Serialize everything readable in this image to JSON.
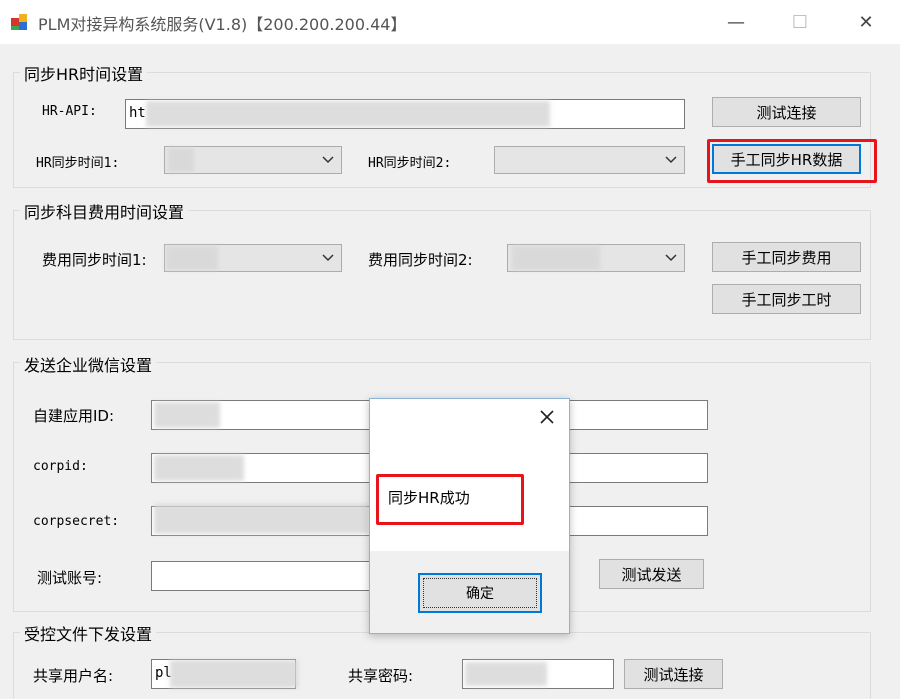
{
  "window": {
    "title": "PLM对接异构系统服务(V1.8)【200.200.200.44】",
    "minimize_glyph": "—",
    "maximize_glyph": "☐",
    "close_glyph": "✕"
  },
  "hr_group": {
    "label": "同步HR时间设置",
    "api_label": "HR-API:",
    "api_value": "ht",
    "time1_label": "HR同步时间1:",
    "time2_label": "HR同步时间2:",
    "test_button": "测试连接",
    "sync_button": "手工同步HR数据"
  },
  "cost_group": {
    "label": "同步科目费用时间设置",
    "time1_label": "费用同步时间1:",
    "time2_label": "费用同步时间2:",
    "sync_cost_button": "手工同步费用",
    "sync_hours_button": "手工同步工时"
  },
  "wechat_group": {
    "label": "发送企业微信设置",
    "appid_label": "自建应用ID:",
    "corpid_label": "corpid:",
    "corpsecret_label": "corpsecret:",
    "test_account_label": "测试账号:",
    "send_button": "测试发送"
  },
  "file_group": {
    "label": "受控文件下发设置",
    "user_label": "共享用户名:",
    "user_value": "pl",
    "password_label": "共享密码:",
    "test_button": "测试连接"
  },
  "dialog": {
    "message": "同步HR成功",
    "ok_button": "确定"
  },
  "colors": {
    "highlight": "#e8141c",
    "focus": "#0078d7"
  }
}
